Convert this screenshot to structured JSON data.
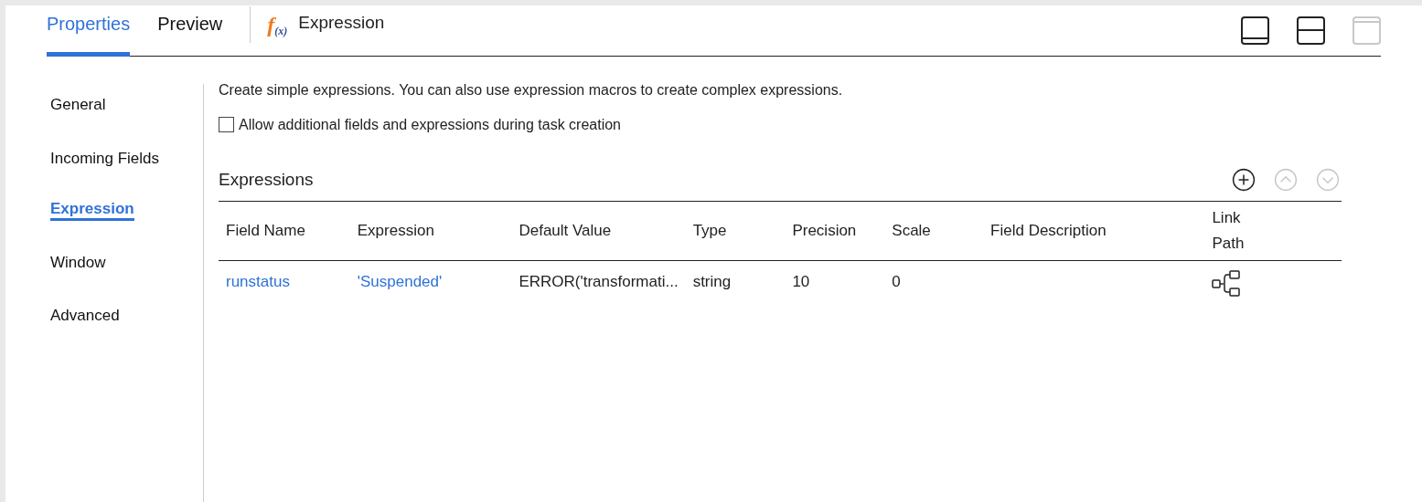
{
  "tabs": [
    {
      "label": "Properties",
      "selected": true
    },
    {
      "label": "Preview",
      "selected": false
    }
  ],
  "header": {
    "icon_letter": "f",
    "icon_sub": "(x)",
    "title": "Expression"
  },
  "layout_buttons": [
    {
      "kind": "bottom",
      "disabled": false
    },
    {
      "kind": "split",
      "disabled": false
    },
    {
      "kind": "top",
      "disabled": true
    }
  ],
  "sidebar": {
    "items": [
      {
        "label": "General",
        "selected": false
      },
      {
        "label": "Incoming Fields",
        "selected": false
      },
      {
        "label": "Expression",
        "selected": true
      },
      {
        "label": "Window",
        "selected": false
      },
      {
        "label": "Advanced",
        "selected": false
      }
    ]
  },
  "description": "Create simple expressions. You can also use expression macros to create complex expressions.",
  "allow_checkbox": {
    "label": "Allow additional fields and expressions during task creation",
    "checked": false
  },
  "section_title": "Expressions",
  "section_buttons": [
    {
      "kind": "add",
      "disabled": false
    },
    {
      "kind": "up",
      "disabled": true
    },
    {
      "kind": "down",
      "disabled": true
    }
  ],
  "table": {
    "columns": [
      "Field Name",
      "Expression",
      "Default Value",
      "Type",
      "Precision",
      "Scale",
      "Field Description",
      "Link\nPath"
    ],
    "rows": [
      {
        "cells": [
          "runstatus",
          "'Suspended'",
          "ERROR('transformati...",
          "string",
          "10",
          "0",
          ""
        ],
        "link_path": true
      }
    ]
  }
}
